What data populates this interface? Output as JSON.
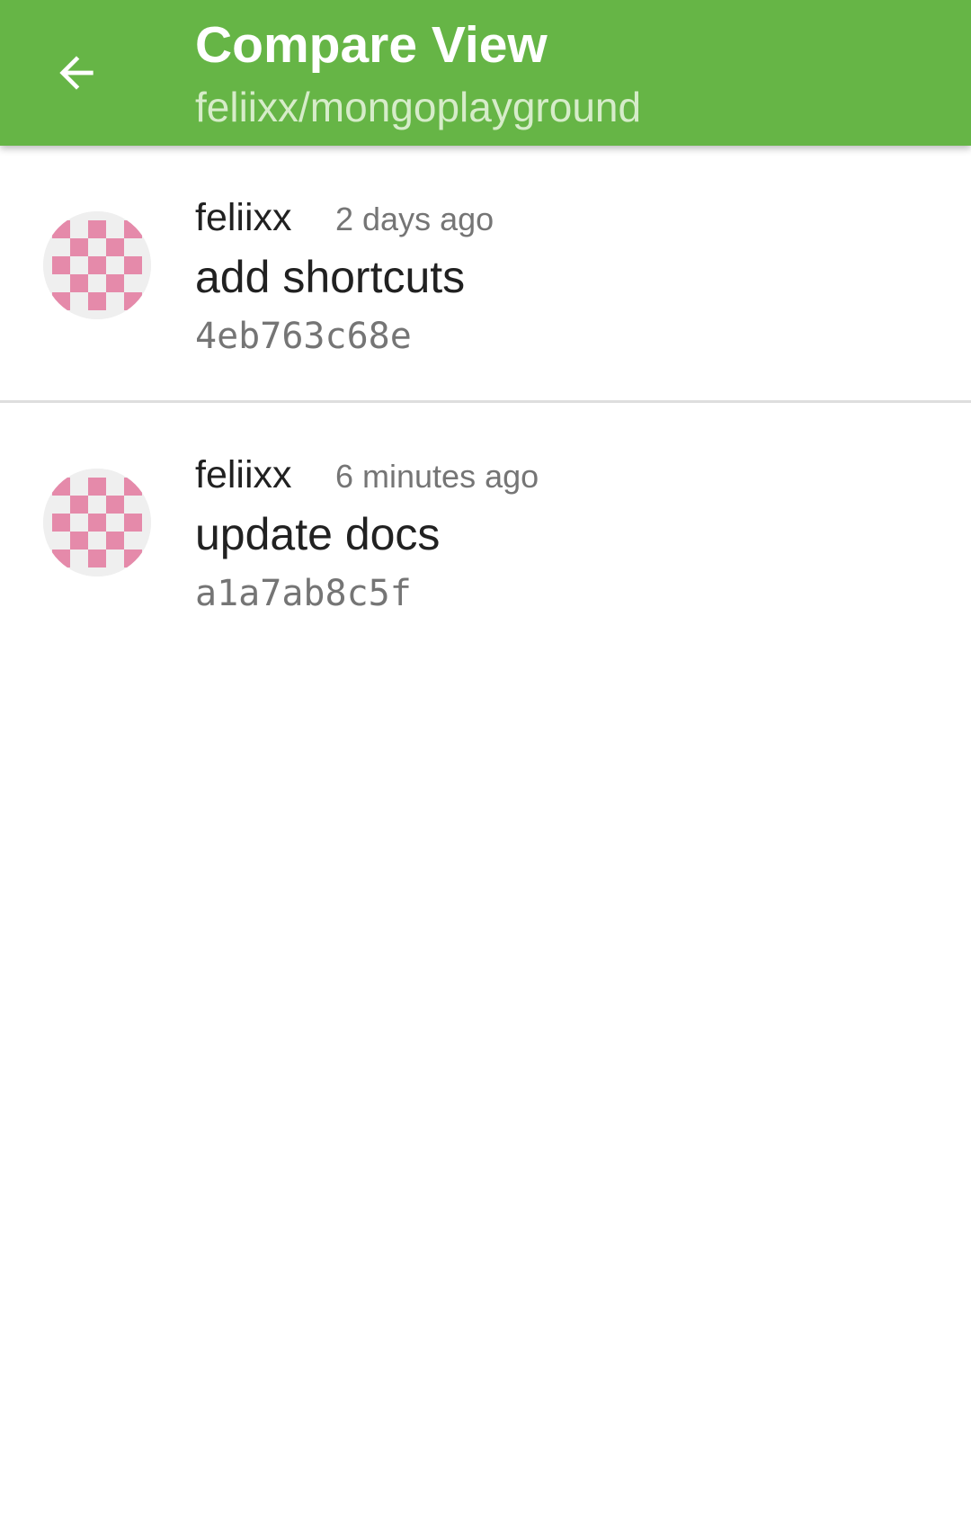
{
  "toolbar": {
    "title": "Compare View",
    "subtitle": "feliixx/mongoplayground",
    "back_icon": "arrow-back-icon",
    "color": "#66b546"
  },
  "commits": [
    {
      "author": "feliixx",
      "time": "2 days ago",
      "message": "add shortcuts",
      "sha": "4eb763c68e",
      "avatar_icon": "identicon-avatar"
    },
    {
      "author": "feliixx",
      "time": "6 minutes ago",
      "message": "update docs",
      "sha": "a1a7ab8c5f",
      "avatar_icon": "identicon-avatar"
    }
  ],
  "colors": {
    "avatar_pink": "#e58aaa",
    "avatar_bg": "#efefef",
    "divider": "#dedede"
  }
}
